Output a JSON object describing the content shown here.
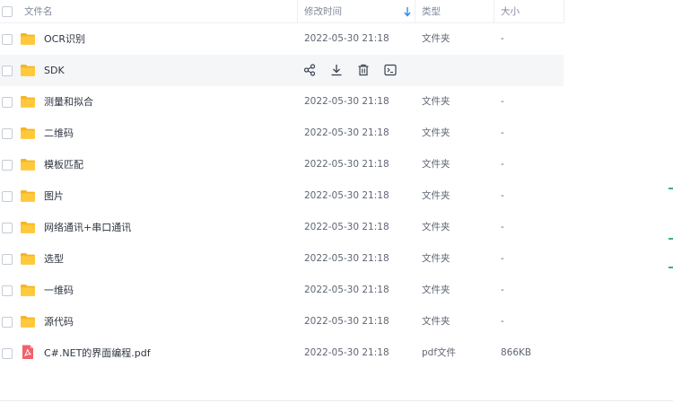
{
  "header": {
    "col_name": "文件名",
    "col_time": "修改时间",
    "col_type": "类型",
    "col_size": "大小",
    "sort_icon": "arrow-down-icon"
  },
  "rows": [
    {
      "name": "OCR识别",
      "time": "2022-05-30 21:18",
      "type": "文件夹",
      "size": "-",
      "icon": "folder-icon"
    },
    {
      "name": "SDK",
      "time": "",
      "type": "",
      "size": "",
      "icon": "folder-icon",
      "hover": true
    },
    {
      "name": "测量和拟合",
      "time": "2022-05-30 21:18",
      "type": "文件夹",
      "size": "-",
      "icon": "folder-icon"
    },
    {
      "name": "二维码",
      "time": "2022-05-30 21:18",
      "type": "文件夹",
      "size": "-",
      "icon": "folder-icon"
    },
    {
      "name": "模板匹配",
      "time": "2022-05-30 21:18",
      "type": "文件夹",
      "size": "-",
      "icon": "folder-icon"
    },
    {
      "name": "图片",
      "time": "2022-05-30 21:18",
      "type": "文件夹",
      "size": "-",
      "icon": "folder-icon"
    },
    {
      "name": "网络通讯+串口通讯",
      "time": "2022-05-30 21:18",
      "type": "文件夹",
      "size": "-",
      "icon": "folder-icon"
    },
    {
      "name": "选型",
      "time": "2022-05-30 21:18",
      "type": "文件夹",
      "size": "-",
      "icon": "folder-icon"
    },
    {
      "name": "一维码",
      "time": "2022-05-30 21:18",
      "type": "文件夹",
      "size": "-",
      "icon": "folder-icon"
    },
    {
      "name": "源代码",
      "time": "2022-05-30 21:18",
      "type": "文件夹",
      "size": "-",
      "icon": "folder-icon"
    },
    {
      "name": "C#.NET的界面编程.pdf",
      "time": "2022-05-30 21:18",
      "type": "pdf文件",
      "size": "866KB",
      "icon": "pdf-icon"
    }
  ],
  "hover_actions": [
    "share-icon",
    "download-icon",
    "delete-icon",
    "rename-icon"
  ],
  "colors": {
    "folder": "#ffc93c",
    "folder_back": "#f5b524",
    "pdf": "#f2616a",
    "sort_arrow": "#2e8cf0",
    "hover_bg": "#f5f6f8"
  }
}
